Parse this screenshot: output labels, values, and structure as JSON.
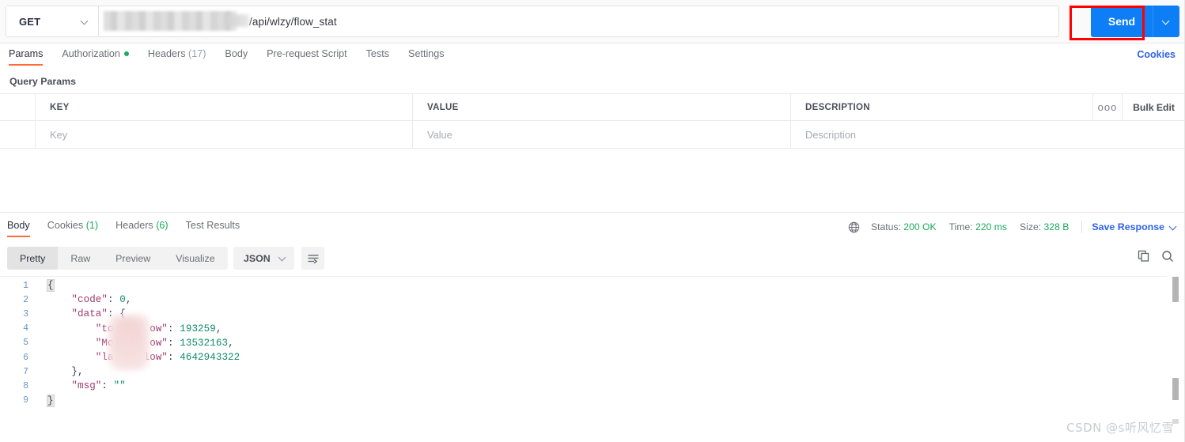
{
  "request": {
    "method": "GET",
    "url_visible": "/api/wlzy/flow_stat",
    "url_redacted": true,
    "send_label": "Send",
    "cookies_label": "Cookies",
    "tabs": [
      {
        "label": "Params",
        "active": true
      },
      {
        "label": "Authorization",
        "dot": true
      },
      {
        "label": "Headers",
        "count": "(17)"
      },
      {
        "label": "Body"
      },
      {
        "label": "Pre-request Script"
      },
      {
        "label": "Tests"
      },
      {
        "label": "Settings"
      }
    ]
  },
  "query_params": {
    "section_title": "Query Params",
    "columns": [
      "KEY",
      "VALUE",
      "DESCRIPTION"
    ],
    "row_placeholders": [
      "Key",
      "Value",
      "Description"
    ],
    "bulk_edit_label": "Bulk Edit",
    "more_glyph": "ooo"
  },
  "response": {
    "tabs": [
      {
        "label": "Body",
        "active": true
      },
      {
        "label": "Cookies",
        "count": "(1)"
      },
      {
        "label": "Headers",
        "count": "(6)"
      },
      {
        "label": "Test Results"
      }
    ],
    "status_label": "Status:",
    "status_value": "200 OK",
    "time_label": "Time:",
    "time_value": "220 ms",
    "size_label": "Size:",
    "size_value": "328 B",
    "save_response_label": "Save Response",
    "view_modes": [
      {
        "label": "Pretty",
        "active": true
      },
      {
        "label": "Raw"
      },
      {
        "label": "Preview"
      },
      {
        "label": "Visualize"
      }
    ],
    "format": "JSON",
    "code_lines": [
      {
        "n": "1",
        "segments": [
          {
            "t": "{",
            "c": "brace"
          }
        ]
      },
      {
        "n": "2",
        "segments": [
          {
            "t": "    \"code\"",
            "c": "key"
          },
          {
            "t": ": ",
            "c": "punc"
          },
          {
            "t": "0",
            "c": "num"
          },
          {
            "t": ",",
            "c": "punc"
          }
        ]
      },
      {
        "n": "3",
        "segments": [
          {
            "t": "    \"data\"",
            "c": "key"
          },
          {
            "t": ": {",
            "c": "punc"
          }
        ]
      },
      {
        "n": "4",
        "segments": [
          {
            "t": "        \"to",
            "c": "key"
          },
          {
            "t": "      ow\"",
            "c": "key"
          },
          {
            "t": ": ",
            "c": "punc"
          },
          {
            "t": "193259",
            "c": "num"
          },
          {
            "t": ",",
            "c": "punc"
          }
        ]
      },
      {
        "n": "5",
        "segments": [
          {
            "t": "        \"Mo",
            "c": "key"
          },
          {
            "t": "      ow\"",
            "c": "key"
          },
          {
            "t": ": ",
            "c": "punc"
          },
          {
            "t": "13532163",
            "c": "num"
          },
          {
            "t": ",",
            "c": "punc"
          }
        ]
      },
      {
        "n": "6",
        "segments": [
          {
            "t": "        \"la",
            "c": "key"
          },
          {
            "t": "    Flow\"",
            "c": "key"
          },
          {
            "t": ": ",
            "c": "punc"
          },
          {
            "t": "4642943322",
            "c": "num"
          }
        ]
      },
      {
        "n": "7",
        "segments": [
          {
            "t": "    },",
            "c": "punc"
          }
        ]
      },
      {
        "n": "8",
        "segments": [
          {
            "t": "    \"msg\"",
            "c": "key"
          },
          {
            "t": ": ",
            "c": "punc"
          },
          {
            "t": "\"\"",
            "c": "str"
          }
        ]
      },
      {
        "n": "9",
        "segments": [
          {
            "t": "}",
            "c": "brace"
          }
        ]
      }
    ]
  },
  "watermark": "CSDN @s听风忆雪",
  "colors": {
    "accent_orange": "#ff6c37",
    "send_blue": "#0d7ef5",
    "link_blue": "#2e63e8",
    "status_green": "#1bab5d",
    "annotation_red": "#fe0000"
  }
}
